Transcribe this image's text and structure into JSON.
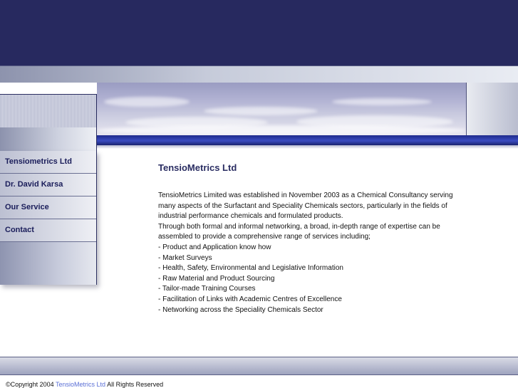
{
  "nav": {
    "items": [
      {
        "label": "Tensiometrics Ltd"
      },
      {
        "label": "Dr. David Karsa"
      },
      {
        "label": "Our Service"
      },
      {
        "label": "Contact"
      }
    ]
  },
  "main": {
    "title": "TensioMetrics Ltd",
    "paragraphs": [
      "TensioMetrics Limited was established in November 2003 as a Chemical Consultancy serving many aspects of the Surfactant and Speciality Chemicals sectors, particularly in the fields of industrial performance chemicals and formulated products.",
      "Through both formal and informal networking, a broad, in-depth range of expertise can be assembled to provide a comprehensive range of services including;"
    ],
    "services": [
      "- Product and Application know how",
      "- Market Surveys",
      "- Health, Safety, Environmental and Legislative Information",
      "- Raw Material and Product Sourcing",
      "- Tailor-made Training Courses",
      "- Facilitation of Links with Academic Centres of Excellence",
      "- Networking across the Speciality Chemicals Sector"
    ]
  },
  "footer": {
    "prefix": "©Copyright 2004",
    "link": "TensioMetrics Ltd",
    "suffix": "All Rights Reserved"
  },
  "colors": {
    "header_navy": "#27295f",
    "stripe_blue": "#3b4cc0",
    "nav_text": "#1a1d5a",
    "footer_link": "#5a6fd6"
  }
}
